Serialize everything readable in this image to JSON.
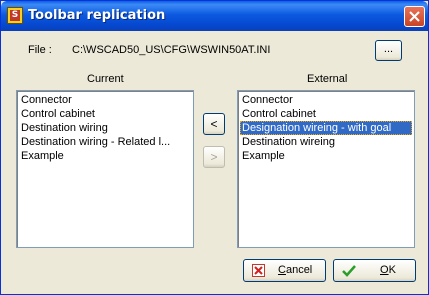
{
  "window": {
    "title": "Toolbar replication",
    "icon": "wscad-s-icon",
    "close_icon": "close-icon"
  },
  "file": {
    "label": "File :",
    "path": "C:\\WSCAD50_US\\CFG\\WSWIN50AT.INI",
    "browse_label": "..."
  },
  "current": {
    "label": "Current",
    "items": [
      {
        "label": "Connector"
      },
      {
        "label": "Control cabinet"
      },
      {
        "label": "Destination wiring"
      },
      {
        "label": "Destination wiring - Related l..."
      },
      {
        "label": "Example"
      }
    ]
  },
  "external": {
    "label": "External",
    "items": [
      {
        "label": "Connector"
      },
      {
        "label": "Control cabinet"
      },
      {
        "label": "Designation wireing - with goal"
      },
      {
        "label": "Destination wireing"
      },
      {
        "label": "Example"
      }
    ],
    "selected_index": 2
  },
  "arrows": {
    "left": "<",
    "right": ">",
    "right_enabled": false
  },
  "buttons": {
    "cancel": {
      "label_u": "C",
      "label_rest": "ancel",
      "icon": "red-x-icon"
    },
    "ok": {
      "label_u": "O",
      "label_rest": "K",
      "icon": "green-check-icon"
    }
  },
  "colors": {
    "titlebar": "#0548d0",
    "selection": "#316ac5",
    "face": "#ece9d8"
  }
}
